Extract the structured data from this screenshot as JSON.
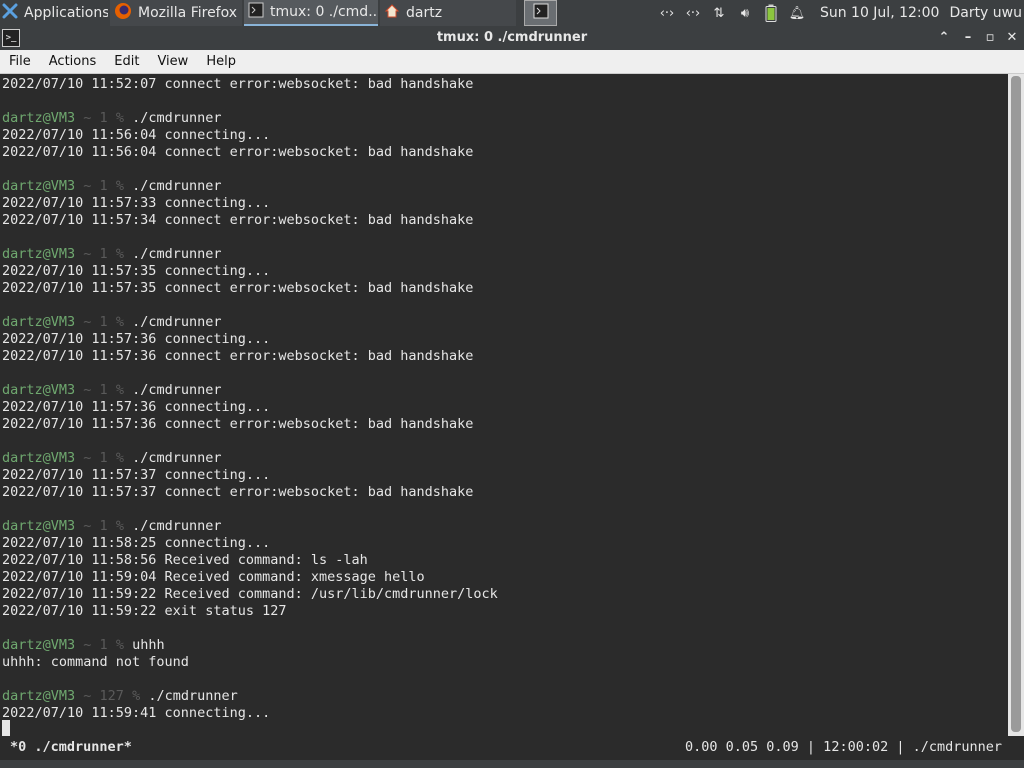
{
  "panel": {
    "applications_label": "Applications",
    "tasks": [
      {
        "label": "Mozilla Firefox"
      },
      {
        "label": "tmux: 0 ./cmd..."
      },
      {
        "label": "dartz"
      }
    ],
    "clock": "Sun 10 Jul, 12:00",
    "user": "Darty uwu"
  },
  "window": {
    "title": "tmux: 0 ./cmdrunner"
  },
  "menu": [
    "File",
    "Actions",
    "Edit",
    "View",
    "Help"
  ],
  "prompt": {
    "user_host": "dartz@VM3",
    "tilde": " ~ ",
    "symbol": " % "
  },
  "terminal": {
    "lines": [
      {
        "t": "out",
        "text": "2022/07/10 11:52:07 connect error:websocket: bad handshake"
      },
      {
        "t": "blank"
      },
      {
        "t": "prompt",
        "status": "1",
        "cmd": "./cmdrunner"
      },
      {
        "t": "out",
        "text": "2022/07/10 11:56:04 connecting..."
      },
      {
        "t": "out",
        "text": "2022/07/10 11:56:04 connect error:websocket: bad handshake"
      },
      {
        "t": "blank"
      },
      {
        "t": "prompt",
        "status": "1",
        "cmd": "./cmdrunner"
      },
      {
        "t": "out",
        "text": "2022/07/10 11:57:33 connecting..."
      },
      {
        "t": "out",
        "text": "2022/07/10 11:57:34 connect error:websocket: bad handshake"
      },
      {
        "t": "blank"
      },
      {
        "t": "prompt",
        "status": "1",
        "cmd": "./cmdrunner"
      },
      {
        "t": "out",
        "text": "2022/07/10 11:57:35 connecting..."
      },
      {
        "t": "out",
        "text": "2022/07/10 11:57:35 connect error:websocket: bad handshake"
      },
      {
        "t": "blank"
      },
      {
        "t": "prompt",
        "status": "1",
        "cmd": "./cmdrunner"
      },
      {
        "t": "out",
        "text": "2022/07/10 11:57:36 connecting..."
      },
      {
        "t": "out",
        "text": "2022/07/10 11:57:36 connect error:websocket: bad handshake"
      },
      {
        "t": "blank"
      },
      {
        "t": "prompt",
        "status": "1",
        "cmd": "./cmdrunner"
      },
      {
        "t": "out",
        "text": "2022/07/10 11:57:36 connecting..."
      },
      {
        "t": "out",
        "text": "2022/07/10 11:57:36 connect error:websocket: bad handshake"
      },
      {
        "t": "blank"
      },
      {
        "t": "prompt",
        "status": "1",
        "cmd": "./cmdrunner"
      },
      {
        "t": "out",
        "text": "2022/07/10 11:57:37 connecting..."
      },
      {
        "t": "out",
        "text": "2022/07/10 11:57:37 connect error:websocket: bad handshake"
      },
      {
        "t": "blank"
      },
      {
        "t": "prompt",
        "status": "1",
        "cmd": "./cmdrunner"
      },
      {
        "t": "out",
        "text": "2022/07/10 11:58:25 connecting..."
      },
      {
        "t": "out",
        "text": "2022/07/10 11:58:56 Received command: ls -lah"
      },
      {
        "t": "out",
        "text": "2022/07/10 11:59:04 Received command: xmessage hello"
      },
      {
        "t": "out",
        "text": "2022/07/10 11:59:22 Received command: /usr/lib/cmdrunner/lock"
      },
      {
        "t": "out",
        "text": "2022/07/10 11:59:22 exit status 127"
      },
      {
        "t": "blank"
      },
      {
        "t": "prompt",
        "status": "1",
        "cmd": "uhhh"
      },
      {
        "t": "out",
        "text": "uhhh: command not found"
      },
      {
        "t": "blank"
      },
      {
        "t": "prompt",
        "status": "127",
        "cmd": "./cmdrunner"
      },
      {
        "t": "out",
        "text": "2022/07/10 11:59:41 connecting..."
      }
    ]
  },
  "status": {
    "left": "*0 ./cmdrunner*",
    "right": "0.00 0.05 0.09 | 12:00:02 | ./cmdrunner"
  },
  "colors": {
    "prompt_user": "#6fa86f",
    "prompt_dim": "#5a5a5a",
    "terminal_bg": "#2b2b2b"
  }
}
